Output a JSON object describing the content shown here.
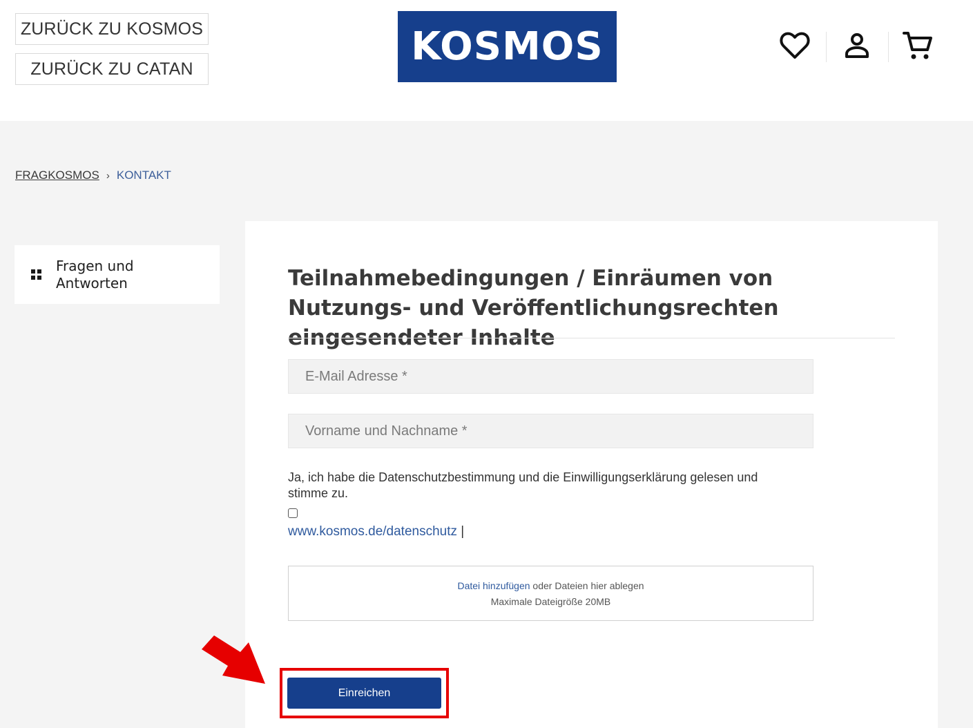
{
  "header": {
    "back_buttons": [
      "ZURÜCK ZU KOSMOS",
      "ZURÜCK ZU CATAN"
    ],
    "logo_text": "KOSMOS",
    "icons": [
      "heart-icon",
      "user-icon",
      "cart-icon"
    ],
    "brand_color": "#163f8c"
  },
  "breadcrumb": {
    "home": "FRAGKOSMOS",
    "separator": "›",
    "current": "KONTAKT"
  },
  "sidebar": {
    "item_label": "Fragen und Antworten",
    "icon": "grid-icon"
  },
  "form": {
    "title": "Teilnahmebedingungen / Einräumen von Nutzungs- und Veröffentlichungsrechten eingesendeter Inhalte",
    "email_placeholder": "E-Mail Adresse *",
    "name_placeholder": "Vorname und Nachname *",
    "consent_text": "Ja, ich habe die Datenschutzbestimmung und die Einwilligungserklärung gelesen und stimme zu.",
    "privacy_link": "www.kosmos.de/datenschutz",
    "privacy_suffix": " |",
    "dropzone_link": "Datei hinzufügen",
    "dropzone_text": " oder Dateien hier ablegen",
    "dropzone_limit": "Maximale Dateigröße 20MB",
    "submit_label": "Einreichen"
  },
  "annotation": {
    "highlight_color": "#e60000"
  }
}
